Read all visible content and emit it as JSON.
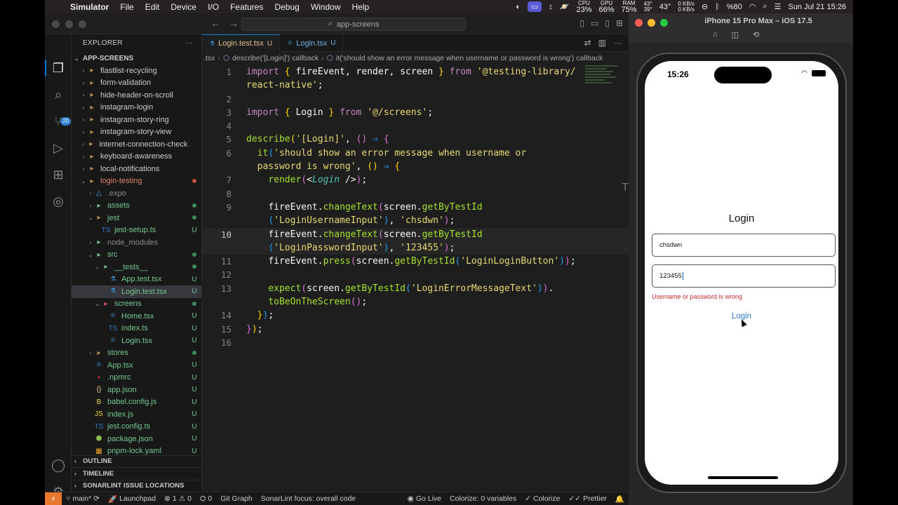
{
  "menubar": {
    "app": "Simulator",
    "items": [
      "File",
      "Edit",
      "Device",
      "I/O",
      "Features",
      "Debug",
      "Window",
      "Help"
    ],
    "cpu_value": "23%",
    "cpu_label": "CPU",
    "gpu_value": "66%",
    "gpu_label": "GPU",
    "ram_value": "75%",
    "ram_label": "RAM",
    "temp_top": "43°",
    "temp_bottom": "39°",
    "temp_big": "43°",
    "net_up": "0 KB/s",
    "net_down": "0 KB/s",
    "battery": "%80",
    "datetime": "Sun Jul 21  15:26"
  },
  "vscode": {
    "search_placeholder": "app-screens",
    "explorer_title": "EXPLORER",
    "root_name": "APP-SCREENS",
    "tree": [
      {
        "label": "flastlist-recycling",
        "indent": 1,
        "type": "folder",
        "chev": "›",
        "git": "",
        "state": "normal"
      },
      {
        "label": "form-validation",
        "indent": 1,
        "type": "folder",
        "chev": "›",
        "git": "",
        "state": "normal"
      },
      {
        "label": "hide-header-on-scroll",
        "indent": 1,
        "type": "folder",
        "chev": "›",
        "git": "",
        "state": "normal"
      },
      {
        "label": "instagram-login",
        "indent": 1,
        "type": "folder",
        "chev": "›",
        "git": "",
        "state": "normal"
      },
      {
        "label": "instagram-story-ring",
        "indent": 1,
        "type": "folder",
        "chev": "›",
        "git": "",
        "state": "normal"
      },
      {
        "label": "instagram-story-view",
        "indent": 1,
        "type": "folder",
        "chev": "›",
        "git": "",
        "state": "normal"
      },
      {
        "label": "internet-connection-check",
        "indent": 1,
        "type": "folder",
        "chev": "›",
        "git": "",
        "state": "normal"
      },
      {
        "label": "keyboard-awareness",
        "indent": 1,
        "type": "folder",
        "chev": "›",
        "git": "",
        "state": "normal"
      },
      {
        "label": "local-notifications",
        "indent": 1,
        "type": "folder",
        "chev": "›",
        "git": "",
        "state": "normal"
      },
      {
        "label": "login-testing",
        "indent": 1,
        "type": "folder",
        "chev": "⌄",
        "git": "dot-red",
        "state": "orange"
      },
      {
        "label": ".expo",
        "indent": 2,
        "type": "expo",
        "chev": "›",
        "git": "",
        "state": "dim"
      },
      {
        "label": "assets",
        "indent": 2,
        "type": "folder-green",
        "chev": "›",
        "git": "dot-green",
        "state": "green"
      },
      {
        "label": "jest",
        "indent": 2,
        "type": "folder",
        "chev": "⌄",
        "git": "dot-green",
        "state": "green"
      },
      {
        "label": "jest-setup.ts",
        "indent": 3,
        "type": "ts",
        "chev": "",
        "git": "U",
        "state": "green"
      },
      {
        "label": "node_modules",
        "indent": 2,
        "type": "folder-green",
        "chev": "›",
        "git": "",
        "state": "dim"
      },
      {
        "label": "src",
        "indent": 2,
        "type": "folder-green",
        "chev": "⌄",
        "git": "dot-green",
        "state": "green"
      },
      {
        "label": "__tests__",
        "indent": 3,
        "type": "folder-green",
        "chev": "⌄",
        "git": "dot-green",
        "state": "green"
      },
      {
        "label": "App.test.tsx",
        "indent": 4,
        "type": "test",
        "chev": "",
        "git": "U",
        "state": "green"
      },
      {
        "label": "Login.test.tsx",
        "indent": 4,
        "type": "test",
        "chev": "",
        "git": "U",
        "state": "green-selected"
      },
      {
        "label": "screens",
        "indent": 3,
        "type": "folder-red",
        "chev": "⌄",
        "git": "dot-green",
        "state": "green"
      },
      {
        "label": "Home.tsx",
        "indent": 4,
        "type": "tsx",
        "chev": "",
        "git": "U",
        "state": "green"
      },
      {
        "label": "index.ts",
        "indent": 4,
        "type": "ts",
        "chev": "",
        "git": "U",
        "state": "green"
      },
      {
        "label": "Login.tsx",
        "indent": 4,
        "type": "tsx",
        "chev": "",
        "git": "U",
        "state": "green"
      },
      {
        "label": "stores",
        "indent": 2,
        "type": "folder",
        "chev": "›",
        "git": "dot-green",
        "state": "green"
      },
      {
        "label": "App.tsx",
        "indent": 2,
        "type": "tsx",
        "chev": "",
        "git": "U",
        "state": "green"
      },
      {
        "label": ".npmrc",
        "indent": 2,
        "type": "npm",
        "chev": "",
        "git": "U",
        "state": "green"
      },
      {
        "label": "app.json",
        "indent": 2,
        "type": "json",
        "chev": "",
        "git": "U",
        "state": "green"
      },
      {
        "label": "babel.config.js",
        "indent": 2,
        "type": "babel",
        "chev": "",
        "git": "U",
        "state": "green"
      },
      {
        "label": "index.js",
        "indent": 2,
        "type": "js",
        "chev": "",
        "git": "U",
        "state": "green"
      },
      {
        "label": "jest.config.ts",
        "indent": 2,
        "type": "ts",
        "chev": "",
        "git": "U",
        "state": "green"
      },
      {
        "label": "package.json",
        "indent": 2,
        "type": "pkg",
        "chev": "",
        "git": "U",
        "state": "green"
      },
      {
        "label": "pnpm-lock.yaml",
        "indent": 2,
        "type": "yaml",
        "chev": "",
        "git": "U",
        "state": "green"
      }
    ],
    "sections": [
      "OUTLINE",
      "TIMELINE",
      "SONARLINT ISSUE LOCATIONS"
    ],
    "tabs": [
      {
        "label": "Login.test.tsx",
        "status": "U",
        "active": true
      },
      {
        "label": "Login.tsx",
        "status": "U",
        "active": false
      }
    ],
    "breadcrumb": [
      ".tsx",
      "describe('[Login]') callback",
      "it('should show an error message when username or password is wrong') callback"
    ],
    "line_numbers": [
      "1",
      "",
      "2",
      "3",
      "4",
      "5",
      "6",
      "",
      "7",
      "8",
      "9",
      "",
      "10",
      "",
      "11",
      "12",
      "13",
      "",
      "14",
      "15",
      "16"
    ],
    "code_text": {
      "l1a": "import",
      "l1b": "{ fireEvent, render, screen }",
      "l1c": "from",
      "l1d": "'@testing-library/",
      "l1e": "react-native'",
      "l3a": "import",
      "l3b": "{ Login }",
      "l3c": "from",
      "l3d": "'@/screens'",
      "l5a": "describe",
      "l5b": "'[Login]'",
      "l6a": "it",
      "l6b": "'should show an error message when username or",
      "l6c": "password is wrong'",
      "l7a": "render",
      "l7b": "Login",
      "l9a": "fireEvent",
      "l9b": "changeText",
      "l9c": "screen",
      "l9d": "getByTestId",
      "l9e": "'LoginUsernameInput'",
      "l9f": "'chsdwn'",
      "l10a": "fireEvent",
      "l10b": "changeText",
      "l10c": "screen",
      "l10d": "getByTestId",
      "l10e": "'LoginPasswordInput'",
      "l10f": "'123455'",
      "l11a": "fireEvent",
      "l11b": "press",
      "l11c": "screen",
      "l11d": "getByTestId",
      "l11e": "'LoginLoginButton'",
      "l13a": "expect",
      "l13b": "screen",
      "l13c": "getByTestId",
      "l13d": "'LoginErrorMessageText'",
      "l13e": "toBeOnTheScreen"
    },
    "status": {
      "branch": "main*",
      "launchpad": "Launchpad",
      "errors": "1",
      "warnings": "0",
      "ports": "0",
      "git_graph": "Git Graph",
      "sonarlint": "SonarLint focus: overall code",
      "go_live": "Go Live",
      "colorize_vars": "Colorize: 0 variables",
      "colorize": "Colorize",
      "prettier": "Prettier"
    }
  },
  "simulator": {
    "title": "iPhone 15 Pro Max – iOS 17.5",
    "time": "15:26",
    "login_title": "Login",
    "username_value": "chsdwn",
    "password_value": "123455",
    "error_message": "Username or password is wrong",
    "login_button": "Login"
  },
  "colors": {
    "accent": "#0078d4",
    "git_untracked": "#73c991",
    "error_text": "#c62828",
    "ios_link": "#2f78c4"
  }
}
